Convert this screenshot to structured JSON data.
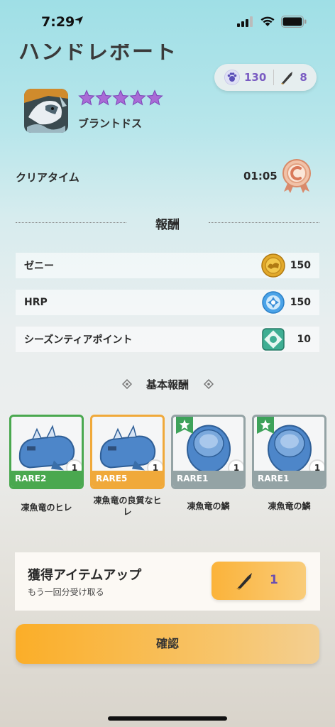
{
  "status_bar": {
    "time": "7:29"
  },
  "page": {
    "heading": "ハンドレポート"
  },
  "currency": {
    "paw_points": "130",
    "knife_count": "8"
  },
  "monster": {
    "name": "ブラントドス",
    "stars": 5
  },
  "clear_time": {
    "label": "クリアタイム",
    "value": "01:05"
  },
  "rewards": {
    "title": "報酬",
    "rows": [
      {
        "label": "ゼニー",
        "value": "150",
        "icon": "zenny-coin-icon"
      },
      {
        "label": "HRP",
        "value": "150",
        "icon": "hrp-icon"
      },
      {
        "label": "シーズンティアポイント",
        "value": "10",
        "icon": "season-tier-icon"
      }
    ]
  },
  "basic_rewards": {
    "title": "基本報酬",
    "items": [
      {
        "rarity": "RARE2",
        "qty": "1",
        "name": "凍魚竜のヒレ",
        "rarity_color": "#4aa84f",
        "art": "fin"
      },
      {
        "rarity": "RARE5",
        "qty": "1",
        "name": "凍魚竜の良質なヒレ",
        "rarity_color": "#f0a93a",
        "art": "fin"
      },
      {
        "rarity": "RARE1",
        "qty": "1",
        "name": "凍魚竜の鱗",
        "rarity_color": "#94a3a5",
        "art": "scale",
        "badge": true
      },
      {
        "rarity": "RARE1",
        "qty": "1",
        "name": "凍魚竜の鱗",
        "rarity_color": "#94a3a5",
        "art": "scale",
        "badge": true
      }
    ]
  },
  "bonus": {
    "title": "獲得アイテムアップ",
    "subtitle": "もう一回分受け取る",
    "count": "1"
  },
  "confirm": {
    "label": "確認"
  }
}
